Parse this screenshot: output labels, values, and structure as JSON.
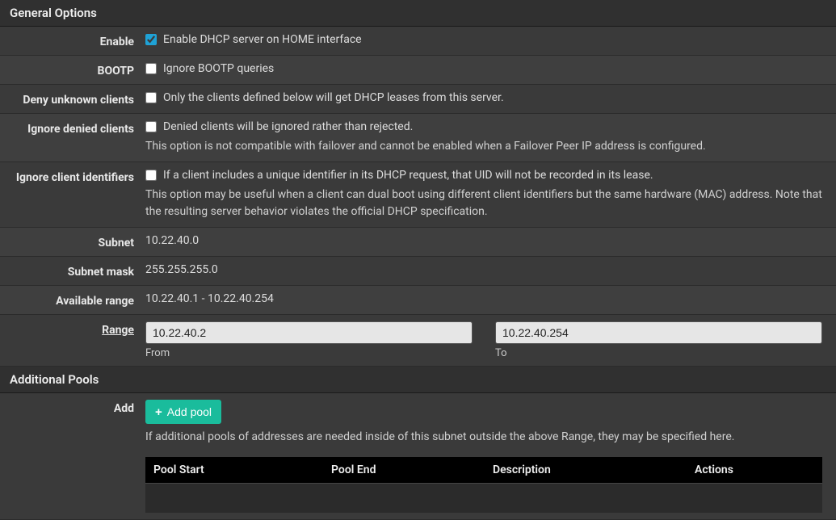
{
  "sections": {
    "general": {
      "title": "General Options"
    },
    "pools": {
      "title": "Additional Pools"
    }
  },
  "rows": {
    "enable": {
      "label": "Enable",
      "checked": true,
      "text": "Enable DHCP server on HOME interface"
    },
    "bootp": {
      "label": "BOOTP",
      "checked": false,
      "text": "Ignore BOOTP queries"
    },
    "deny_unknown": {
      "label": "Deny unknown clients",
      "checked": false,
      "text": "Only the clients defined below will get DHCP leases from this server."
    },
    "ignore_denied": {
      "label": "Ignore denied clients",
      "checked": false,
      "text": "Denied clients will be ignored rather than rejected.",
      "help": "This option is not compatible with failover and cannot be enabled when a Failover Peer IP address is configured."
    },
    "ignore_client_id": {
      "label": "Ignore client identifiers",
      "checked": false,
      "text": "If a client includes a unique identifier in its DHCP request, that UID will not be recorded in its lease.",
      "help": "This option may be useful when a client can dual boot using different client identifiers but the same hardware (MAC) address. Note that the resulting server behavior violates the official DHCP specification."
    },
    "subnet": {
      "label": "Subnet",
      "value": "10.22.40.0"
    },
    "subnet_mask": {
      "label": "Subnet mask",
      "value": "255.255.255.0"
    },
    "available_range": {
      "label": "Available range",
      "value": "10.22.40.1 - 10.22.40.254"
    },
    "range": {
      "label": "Range",
      "from_value": "10.22.40.2",
      "from_label": "From",
      "to_value": "10.22.40.254",
      "to_label": "To"
    }
  },
  "pools": {
    "add_label": "Add",
    "add_button": "Add pool",
    "help": "If additional pools of addresses are needed inside of this subnet outside the above Range, they may be specified here.",
    "columns": {
      "pool_start": "Pool Start",
      "pool_end": "Pool End",
      "description": "Description",
      "actions": "Actions"
    }
  }
}
